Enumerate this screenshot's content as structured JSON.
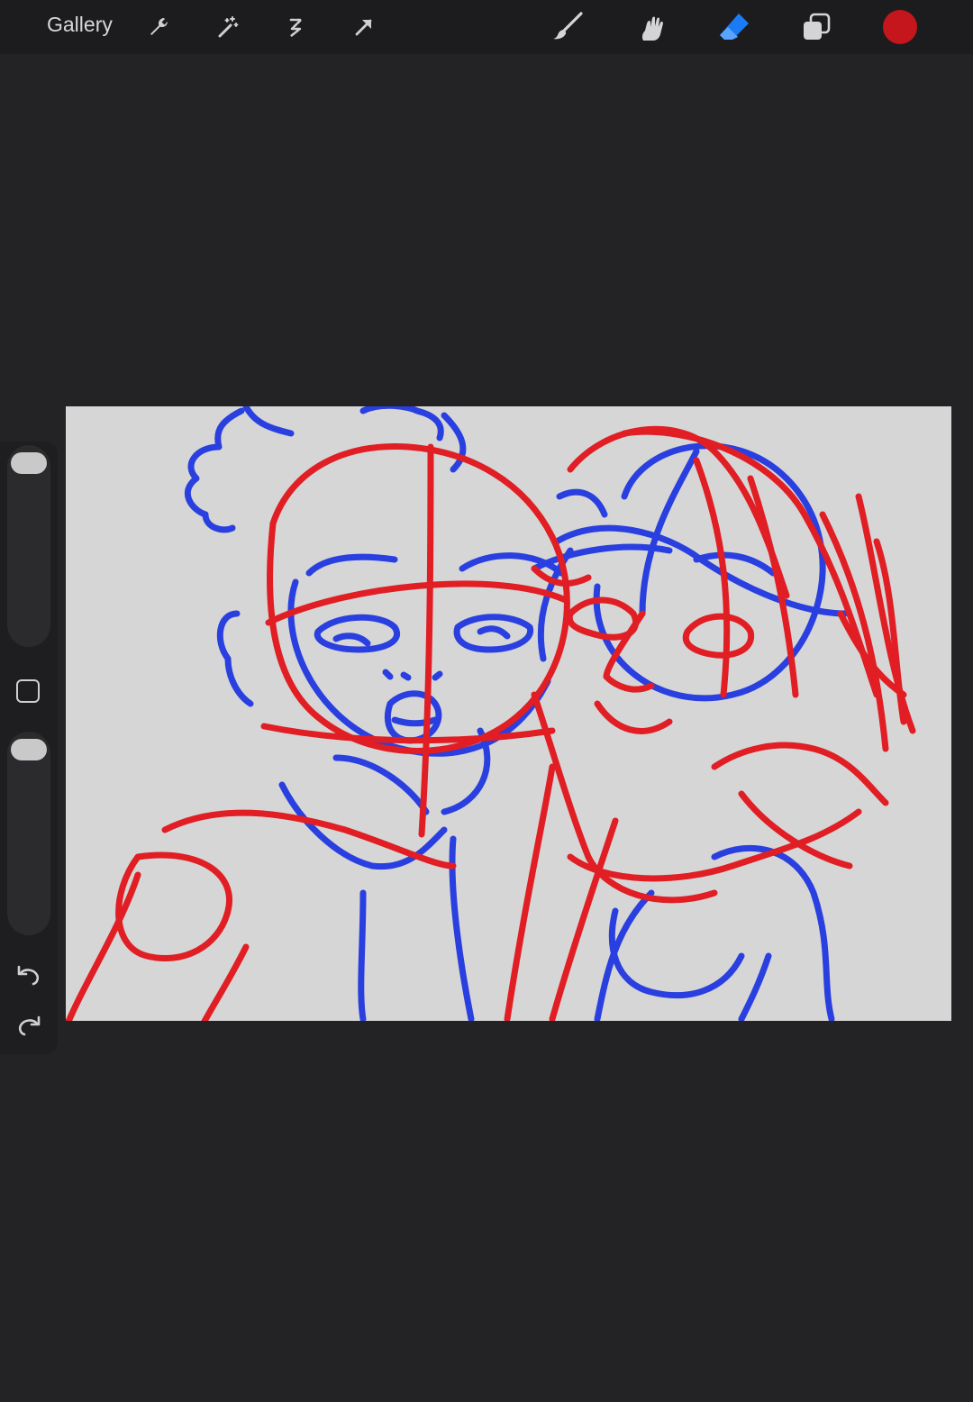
{
  "toolbar": {
    "gallery_label": "Gallery",
    "left_tools": [
      "wrench-icon",
      "magic-wand-icon",
      "selection-icon",
      "transform-arrow-icon"
    ],
    "right_tools": [
      "brush-icon",
      "smudge-icon",
      "eraser-icon",
      "layers-icon"
    ],
    "active_tool": "eraser-icon",
    "current_color": "#c4161c",
    "accent_color": "#1a7cf5"
  },
  "sidebar": {
    "brush_size_level": 1.0,
    "opacity_level": 1.0,
    "icons": [
      "modify-square-icon",
      "undo-icon",
      "redo-icon"
    ]
  },
  "canvas": {
    "background": "#d6d6d6",
    "sketch_colors": [
      "#2a3fe0",
      "#e01e24"
    ]
  }
}
